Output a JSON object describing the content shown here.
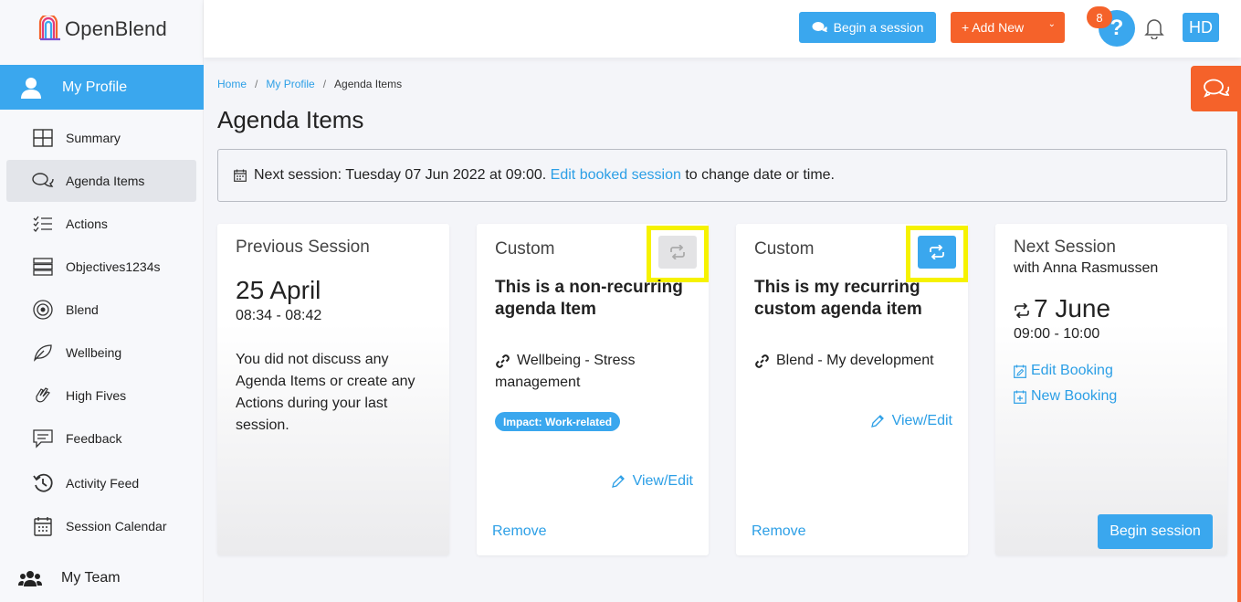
{
  "app": {
    "name": "OpenBlend"
  },
  "sidebar": {
    "profile_label": "My Profile",
    "items": [
      {
        "label": "Summary",
        "icon": "grid-icon"
      },
      {
        "label": "Agenda Items",
        "icon": "chat-bubbles-icon",
        "active": true
      },
      {
        "label": "Actions",
        "icon": "checklist-icon"
      },
      {
        "label": "Objectives1234s",
        "icon": "stack-icon"
      },
      {
        "label": "Blend",
        "icon": "target-icon"
      },
      {
        "label": "Wellbeing",
        "icon": "leaf-icon"
      },
      {
        "label": "High Fives",
        "icon": "clap-icon"
      },
      {
        "label": "Feedback",
        "icon": "message-icon"
      },
      {
        "label": "Activity Feed",
        "icon": "history-icon"
      },
      {
        "label": "Session Calendar",
        "icon": "calendar-icon"
      }
    ],
    "team_label": "My Team"
  },
  "topbar": {
    "begin_session": "Begin a session",
    "add_new": "+ Add New",
    "help": "?",
    "notification_count": "8",
    "avatar": "HD"
  },
  "breadcrumb": {
    "home": "Home",
    "profile": "My Profile",
    "current": "Agenda Items"
  },
  "page_title": "Agenda Items",
  "notice": {
    "prefix": "Next session: Tuesday 07 Jun 2022 at 09:00.",
    "link": "Edit booked session",
    "suffix": "to change date or time."
  },
  "cards": {
    "previous": {
      "title": "Previous Session",
      "date": "25 April",
      "time": "08:34 - 08:42",
      "body": "You did not discuss any Agenda Items or create any Actions during your last session."
    },
    "custom1": {
      "title": "Custom",
      "heading": "This is a non-recurring agenda Item",
      "link": "Wellbeing - Stress management",
      "badge": "Impact: Work-related",
      "view_edit": "View/Edit",
      "remove": "Remove"
    },
    "custom2": {
      "title": "Custom",
      "heading": "This is my recurring custom agenda item",
      "link": "Blend - My development",
      "view_edit": "View/Edit",
      "remove": "Remove"
    },
    "next": {
      "title": "Next Session",
      "with": "with Anna Rasmussen",
      "date": "7 June",
      "time": "09:00 - 10:00",
      "edit_booking": "Edit Booking",
      "new_booking": "New Booking",
      "begin": "Begin session"
    }
  },
  "colors": {
    "primary": "#3aa7ee",
    "accent": "#f5622a",
    "highlight": "#f6f200"
  }
}
